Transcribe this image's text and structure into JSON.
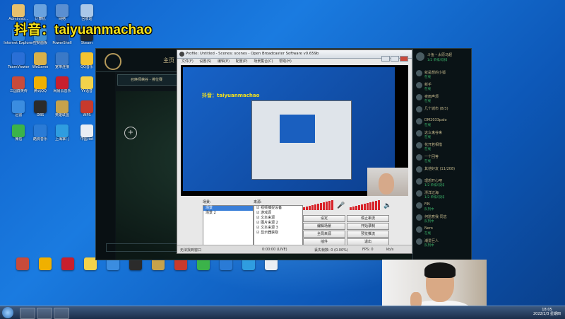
{
  "watermark": "抖音：taiyuanmachao",
  "desktop_icons": [
    {
      "label": "Administr...",
      "color": "#e6c06c"
    },
    {
      "label": "计算机",
      "color": "#6aa2de"
    },
    {
      "label": "网络",
      "color": "#5b8fd1"
    },
    {
      "label": "回收站",
      "color": "#a9c7e8"
    },
    {
      "label": "Internet Explorer",
      "color": "#2b7fd8"
    },
    {
      "label": "控制面板",
      "color": "#3f8fd3"
    },
    {
      "label": "PowerShell",
      "color": "#1d4f9a"
    },
    {
      "label": "Steam",
      "color": "#1b2838"
    },
    {
      "label": "TeamViewer",
      "color": "#2a6fd6"
    },
    {
      "label": "WeGame",
      "color": "#d8b14a"
    },
    {
      "label": "宽带连接",
      "color": "#3a79c7"
    },
    {
      "label": "QQ音乐",
      "color": "#f4c430"
    },
    {
      "label": "三国群英传",
      "color": "#c84b3a"
    },
    {
      "label": "腾讯QQ",
      "color": "#f0b000"
    },
    {
      "label": "网易云音乐",
      "color": "#c81f2d"
    },
    {
      "label": "YY语音",
      "color": "#f3d24a"
    },
    {
      "label": "迅雷",
      "color": "#3b8de0"
    },
    {
      "label": "OBS",
      "color": "#2b2b2b"
    },
    {
      "label": "英雄联盟",
      "color": "#c6a24b"
    },
    {
      "label": "WPS",
      "color": "#c83a2c"
    },
    {
      "label": "微信",
      "color": "#3bb34a"
    },
    {
      "label": "酷狗音乐",
      "color": "#2a7bd6"
    },
    {
      "label": "上海掌门",
      "color": "#2f9de0"
    },
    {
      "label": "中国.txt",
      "color": "#e9eef4"
    }
  ],
  "lol_client": {
    "home": "主页",
    "banner": "召唤师峡谷 - 排位赛",
    "crosshair": "+"
  },
  "friends_panel": {
    "user": "斗鱼丶太原马超",
    "status": "1/2 单排/双排",
    "friends": [
      {
        "name": "就是想的小狐",
        "status": "在线"
      },
      {
        "name": "新手",
        "status": "在线"
      },
      {
        "name": "夜雨声烦",
        "status": "在线"
      },
      {
        "name": "几个城市 (8/3)",
        "status": ""
      },
      {
        "name": "DM2033palo",
        "status": "在线"
      },
      {
        "name": "这么鬼谷来",
        "status": "在线"
      },
      {
        "name": "花开若相惜",
        "status": "在线"
      },
      {
        "name": "一个回答",
        "status": "在线"
      },
      {
        "name": "其他好友 (11/208)",
        "status": ""
      },
      {
        "name": "理想开心吧",
        "status": "1/2 单排/双排"
      },
      {
        "name": "漂洋过海",
        "status": "1/2 单排/双排"
      },
      {
        "name": "FiN",
        "status": "队列中"
      },
      {
        "name": "何愁意我·同志",
        "status": "队列中"
      },
      {
        "name": "Nero",
        "status": "在线"
      },
      {
        "name": "潮爱巨人",
        "status": "队列中"
      }
    ]
  },
  "obs": {
    "title": "Profile: Untitled - Scenes: scenes - Open Broadcaster Software v0.659b",
    "menu": [
      "文件(F)",
      "设置(S)",
      "编辑(E)",
      "配置(P)",
      "场景集合(C)",
      "帮助(H)"
    ],
    "scenes_label": "场景:",
    "scenes": [
      "场景",
      "场景 2"
    ],
    "sources_label": "来源:",
    "sources": [
      "视频捕捉设备",
      "游戏源",
      "文本来源",
      "图片来源 2",
      "文本来源 3",
      "显示器获取"
    ],
    "buttons": {
      "settings": "设定",
      "stop_stream": "停止串流",
      "edit_scene": "编辑场景",
      "start_record": "开始录制",
      "global_sources": "全局来源",
      "preview": "预览推流",
      "plugins": "插件",
      "exit": "退出"
    },
    "status": {
      "left": "无法找到窗口",
      "time": "0:00:00 (LIVE)",
      "dropped": "丢失帧数: 0 (0.00%)",
      "fps": "FPS: 0",
      "kbps": "kb/s"
    }
  },
  "taskbar": {
    "time": "18:05",
    "date": "2022/2/3 星期四"
  }
}
